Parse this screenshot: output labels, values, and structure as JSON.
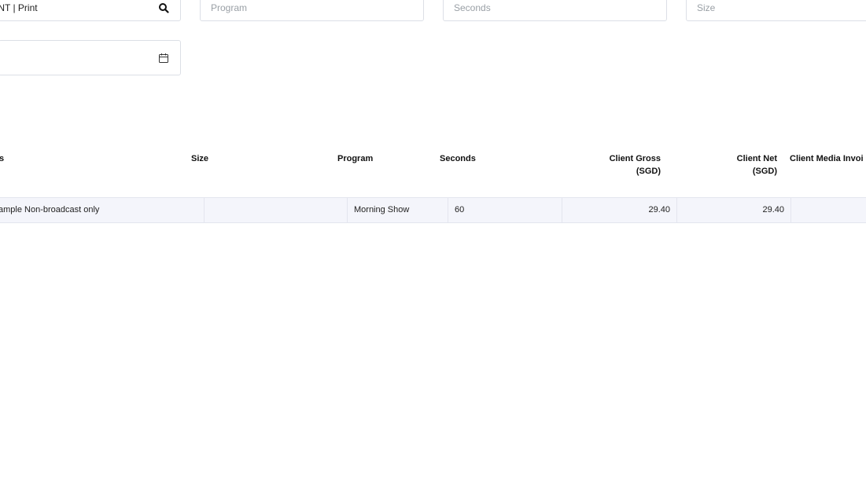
{
  "filters": {
    "media_value": "INT | Print",
    "program_placeholder": "Program",
    "seconds_placeholder": "Seconds",
    "size_placeholder": "Size"
  },
  "icons": {
    "search": "search-icon",
    "calendar": "calendar-icon"
  },
  "table": {
    "headers": {
      "description": "s",
      "size": "Size",
      "program": "Program",
      "seconds": "Seconds",
      "client_gross_line1": "Client Gross",
      "client_gross_line2": "(SGD)",
      "client_net_line1": "Client Net",
      "client_net_line2": "(SGD)",
      "client_media_invoice": "Client Media Invoi"
    },
    "rows": [
      {
        "description": "ample Non-broadcast only",
        "size": "",
        "program": "Morning Show",
        "seconds": "60",
        "client_gross": "29.40",
        "client_net": "29.40",
        "client_media_invoice": ""
      }
    ]
  }
}
